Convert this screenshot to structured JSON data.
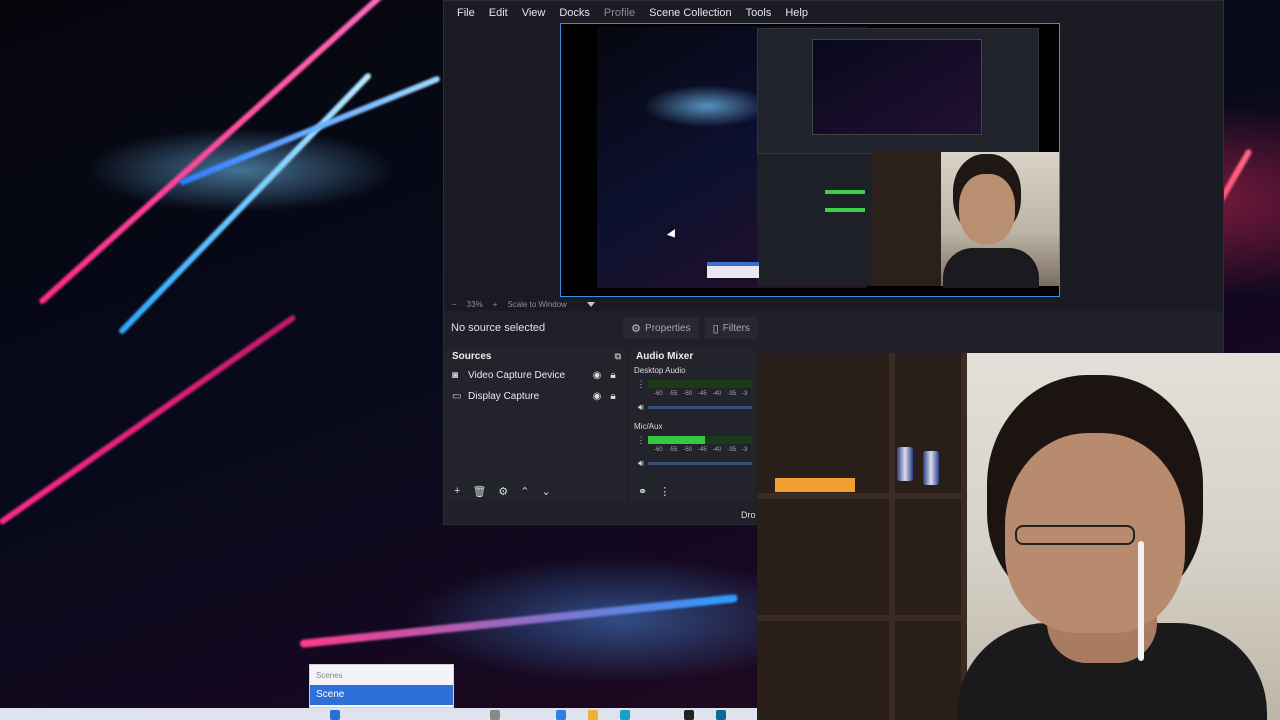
{
  "menu": {
    "items": [
      "File",
      "Edit",
      "View",
      "Docks",
      "Profile",
      "Scene Collection",
      "Tools",
      "Help"
    ],
    "dim_index": 4
  },
  "zoom": {
    "minus": "−",
    "value": "33%",
    "plus": "+",
    "mode": "Scale to Window"
  },
  "context": {
    "status": "No source selected",
    "properties_label": "Properties",
    "filters_label": "Filters"
  },
  "sources": {
    "title": "Sources",
    "items": [
      {
        "label": "Video Capture Device",
        "icon": "camera-icon"
      },
      {
        "label": "Display Capture",
        "icon": "monitor-icon"
      }
    ]
  },
  "mixer": {
    "title": "Audio Mixer",
    "channels": [
      {
        "name": "Desktop Audio",
        "level": 0.0,
        "ticks": [
          "-60",
          "-55",
          "-50",
          "-45",
          "-40",
          "-35",
          "-3"
        ]
      },
      {
        "name": "Mic/Aux",
        "level": 0.55,
        "ticks": [
          "-60",
          "-55",
          "-50",
          "-45",
          "-40",
          "-35",
          "-3"
        ]
      }
    ]
  },
  "dro_label": "Dro",
  "scenes": {
    "title": "Scenes",
    "selected": "Scene"
  },
  "colors": {
    "accent": "#3b8fe0",
    "meter_green": "#36c843",
    "scene_selected": "#2f6fd8"
  }
}
